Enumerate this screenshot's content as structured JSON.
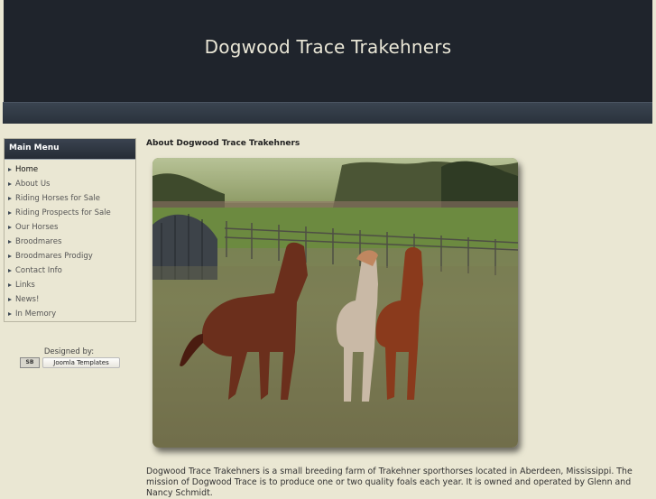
{
  "header": {
    "site_title": "Dogwood Trace Trakehners"
  },
  "sidebar": {
    "title": "Main Menu",
    "items": [
      {
        "label": "Home",
        "active": true
      },
      {
        "label": "About Us"
      },
      {
        "label": "Riding Horses for Sale"
      },
      {
        "label": "Riding Prospects for Sale"
      },
      {
        "label": "Our Horses"
      },
      {
        "label": "Broodmares"
      },
      {
        "label": "Broodmares Prodigy"
      },
      {
        "label": "Contact Info"
      },
      {
        "label": "Links"
      },
      {
        "label": "News!"
      },
      {
        "label": "In Memory"
      }
    ]
  },
  "credits": {
    "designed_by": "Designed by:",
    "logo_text": "SB",
    "link_label": "Joomla Templates"
  },
  "main": {
    "heading": "About Dogwood Trace Trakehners",
    "photo_alt": "Three horses standing in a pasture",
    "paragraph": "Dogwood Trace Trakehners is a small breeding farm of Trakehner sporthorses located in Aberdeen, Mississippi. The mission of Dogwood Trace is to produce one or two quality foals each year. It is owned and operated by Glenn and Nancy Schmidt."
  }
}
